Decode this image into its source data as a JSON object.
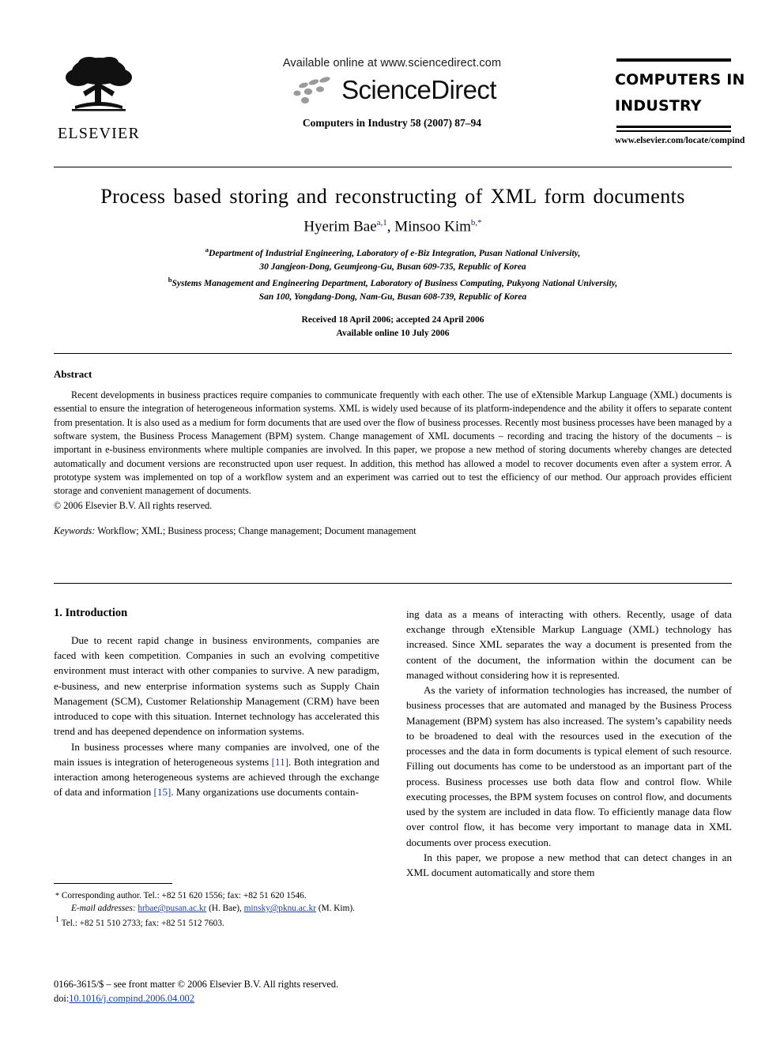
{
  "masthead": {
    "publisher": "ELSEVIER",
    "available_online": "Available online at www.sciencedirect.com",
    "sciencedirect_wordmark": "ScienceDirect",
    "journal_reference": "Computers in Industry 58 (2007) 87–94",
    "journal_logo_line1": "COMPUTERS IN",
    "journal_logo_line2": "INDUSTRY",
    "journal_url": "www.elsevier.com/locate/compind"
  },
  "title_block": {
    "title": "Process based storing and reconstructing of XML form documents",
    "authors": [
      {
        "name": "Hyerim Bae",
        "marks": "a,1"
      },
      {
        "name": "Minsoo Kim",
        "marks": "b,*"
      }
    ],
    "affiliations": [
      {
        "mark": "a",
        "line1": "Department of Industrial Engineering, Laboratory of e-Biz Integration, Pusan National University,",
        "line2": "30 Jangjeon-Dong, Geumjeong-Gu, Busan 609-735, Republic of Korea"
      },
      {
        "mark": "b",
        "line1": "Systems Management and Engineering Department, Laboratory of Business Computing, Pukyong National University,",
        "line2": "San 100, Yongdang-Dong, Nam-Gu, Busan 608-739, Republic of Korea"
      }
    ],
    "received_line": "Received 18 April 2006; accepted 24 April 2006",
    "available_line": "Available online 10 July 2006"
  },
  "abstract": {
    "heading": "Abstract",
    "body": "Recent developments in business practices require companies to communicate frequently with each other. The use of eXtensible Markup Language (XML) documents is essential to ensure the integration of heterogeneous information systems. XML is widely used because of its platform-independence and the ability it offers to separate content from presentation. It is also used as a medium for form documents that are used over the flow of business processes. Recently most business processes have been managed by a software system, the Business Process Management (BPM) system. Change management of XML documents – recording and tracing the history of the documents – is important in e-business environments where multiple companies are involved. In this paper, we propose a new method of storing documents whereby changes are detected automatically and document versions are reconstructed upon user request. In addition, this method has allowed a model to recover documents even after a system error. A prototype system was implemented on top of a workflow system and an experiment was carried out to test the efficiency of our method. Our approach provides efficient storage and convenient management of documents.",
    "copyright": "© 2006 Elsevier B.V. All rights reserved.",
    "keywords_label": "Keywords:",
    "keywords_value": "Workflow; XML; Business process; Change management; Document management"
  },
  "body": {
    "section_heading": "1. Introduction",
    "left_paragraphs": [
      "Due to recent rapid change in business environments, companies are faced with keen competition. Companies in such an evolving competitive environment must interact with other companies to survive. A new paradigm, e-business, and new enterprise information systems such as Supply Chain Management (SCM), Customer Relationship Management (CRM) have been introduced to cope with this situation. Internet technology has accelerated this trend and has deepened dependence on information systems."
    ],
    "left_paragraph_2_parts": {
      "p1": "In business processes where many companies are involved, one of the main issues is integration of heterogeneous systems ",
      "cite1": "[11]",
      "p2": ". Both integration and interaction among heterogeneous systems are achieved through the exchange of data and information ",
      "cite2": "[15]",
      "p3": ". Many organizations use documents contain-"
    },
    "right_paragraphs": [
      "ing data as a means of interacting with others. Recently, usage of data exchange through eXtensible Markup Language (XML) technology has increased. Since XML separates the way a document is presented from the content of the document, the information within the document can be managed without considering how it is represented.",
      "As the variety of information technologies has increased, the number of business processes that are automated and managed by the Business Process Management (BPM) system has also increased. The system’s capability needs to be broadened to deal with the resources used in the execution of the processes and the data in form documents is typical element of such resource. Filling out documents has come to be understood as an important part of the process. Business processes use both data flow and control flow. While executing processes, the BPM system focuses on control flow, and documents used by the system are included in data flow. To efficiently manage data flow over control flow, it has become very important to manage data in XML documents over process execution.",
      "In this paper, we propose a new method that can detect changes in an XML document automatically and store them"
    ]
  },
  "footnotes": {
    "corresponding": "Corresponding author. Tel.: +82 51 620 1556; fax: +82 51 620 1546.",
    "email_label": "E-mail addresses:",
    "email_1": "hrbae@pusan.ac.kr",
    "email_1_owner": "(H. Bae),",
    "email_2": "minsky@pknu.ac.kr",
    "email_2_owner": "(M. Kim).",
    "tel_mark": "1",
    "tel_note": "Tel.: +82 51 510 2733; fax: +82 51 512 7603."
  },
  "imprint": {
    "issn_line": "0166-3615/$ – see front matter © 2006 Elsevier B.V. All rights reserved.",
    "doi_label": "doi:",
    "doi_value": "10.1016/j.compind.2006.04.002"
  },
  "colors": {
    "link": "#1a3fa0",
    "superscript": "#1c2a72",
    "text": "#000000",
    "background": "#ffffff"
  }
}
